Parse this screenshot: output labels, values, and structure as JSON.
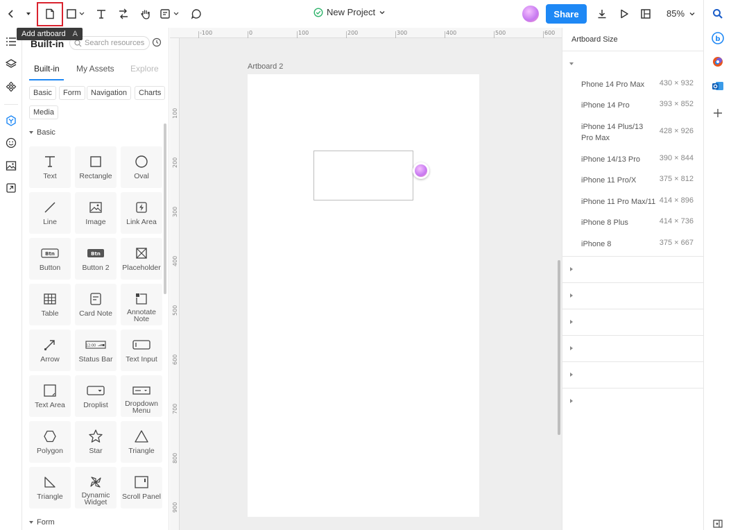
{
  "toolbar": {
    "project_title": "New Project",
    "share_label": "Share",
    "zoom_label": "85%",
    "tooltip_label": "Add artboard",
    "tooltip_shortcut": "A"
  },
  "library": {
    "title": "Built-in",
    "search_placeholder": "Search resources",
    "tabs": [
      "Built-in",
      "My Assets",
      "Explore"
    ],
    "chips": [
      "Basic",
      "Form",
      "Navigation",
      "Charts",
      "Media"
    ],
    "section_basic": "Basic",
    "section_form": "Form",
    "items": [
      {
        "label": "Text",
        "icon": "text-icon"
      },
      {
        "label": "Rectangle",
        "icon": "rectangle-icon"
      },
      {
        "label": "Oval",
        "icon": "oval-icon"
      },
      {
        "label": "Line",
        "icon": "line-icon"
      },
      {
        "label": "Image",
        "icon": "image-icon"
      },
      {
        "label": "Link Area",
        "icon": "link-area-icon"
      },
      {
        "label": "Button",
        "icon": "button-icon"
      },
      {
        "label": "Button 2",
        "icon": "button2-icon"
      },
      {
        "label": "Placeholder",
        "icon": "placeholder-icon"
      },
      {
        "label": "Table",
        "icon": "table-icon"
      },
      {
        "label": "Card Note",
        "icon": "card-note-icon"
      },
      {
        "label": "Annotate Note",
        "icon": "annotate-note-icon"
      },
      {
        "label": "Arrow",
        "icon": "arrow-icon"
      },
      {
        "label": "Status Bar",
        "icon": "status-bar-icon"
      },
      {
        "label": "Text Input",
        "icon": "text-input-icon"
      },
      {
        "label": "Text Area",
        "icon": "text-area-icon"
      },
      {
        "label": "Droplist",
        "icon": "droplist-icon"
      },
      {
        "label": "Dropdown Menu",
        "icon": "dropdown-menu-icon"
      },
      {
        "label": "Polygon",
        "icon": "polygon-icon"
      },
      {
        "label": "Star",
        "icon": "star-icon"
      },
      {
        "label": "Triangle",
        "icon": "triangle-icon"
      },
      {
        "label": "Triangle",
        "icon": "right-triangle-icon"
      },
      {
        "label": "Dynamic Widget",
        "icon": "dynamic-widget-icon"
      },
      {
        "label": "Scroll Panel",
        "icon": "scroll-panel-icon"
      }
    ],
    "button_icon_text": "Btn",
    "status_bar_icon_text": "12:00"
  },
  "canvas": {
    "artboard_label": "Artboard 2",
    "ruler_top": [
      "-100",
      "0",
      "100",
      "200",
      "300",
      "400",
      "500",
      "600"
    ],
    "ruler_left": [
      "100",
      "200",
      "300",
      "400",
      "500",
      "600",
      "700",
      "800",
      "900"
    ]
  },
  "artboard_panel": {
    "title": "Artboard Size",
    "devices": [
      {
        "name": "Phone 14 Pro Max",
        "size": "430 × 932"
      },
      {
        "name": "iPhone 14 Pro",
        "size": "393 × 852"
      },
      {
        "name": "iPhone 14 Plus/13 Pro Max",
        "size": "428 × 926"
      },
      {
        "name": "iPhone 14/13 Pro",
        "size": "390 × 844"
      },
      {
        "name": "iPhone 11 Pro/X",
        "size": "375 × 812"
      },
      {
        "name": "iPhone 11 Pro Max/11",
        "size": "414 × 896"
      },
      {
        "name": "iPhone 8 Plus",
        "size": "414 × 736"
      },
      {
        "name": "iPhone 8",
        "size": "375 × 667"
      }
    ]
  },
  "colors": {
    "accent": "#1e88f5",
    "highlight": "#d9232e",
    "success": "#2fb36b"
  }
}
